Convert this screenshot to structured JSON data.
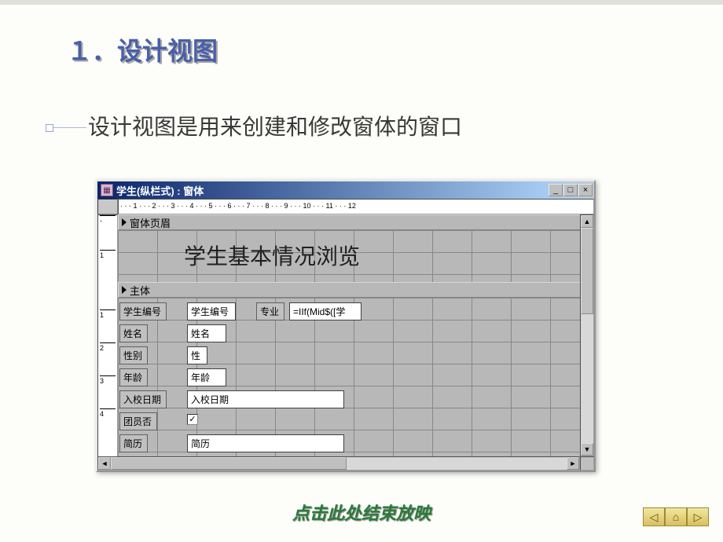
{
  "slide": {
    "title": "１．设计视图",
    "subtitle": "设计视图是用来创建和修改窗体的窗口",
    "footer": "点击此处结束放映"
  },
  "window": {
    "title": "学生(纵栏式) : 窗体",
    "hruler": "· · · 1 · · · 2 · · · 3 · · · 4 · · · 5 · · · 6 · · · 7 · · · 8 · · · 9 · · · 10 · · · 11 · · · 12",
    "sections": {
      "header": "窗体页眉",
      "body": "主体"
    },
    "header_title": "学生基本情况浏览",
    "fields": [
      {
        "label": "学生编号",
        "field": "学生编号",
        "label_pos": [
          2,
          6,
          60
        ],
        "field_pos": [
          88,
          6,
          62
        ]
      },
      {
        "label": "专业",
        "field": "=IIf(Mid$([学",
        "label_pos": [
          176,
          6,
          36
        ],
        "field_pos": [
          218,
          6,
          92
        ]
      },
      {
        "label": "姓名",
        "field": "姓名",
        "label_pos": [
          2,
          34,
          36
        ],
        "field_pos": [
          88,
          34,
          50
        ]
      },
      {
        "label": "性别",
        "field": "性",
        "label_pos": [
          2,
          62,
          36
        ],
        "field_pos": [
          88,
          62,
          26
        ]
      },
      {
        "label": "年龄",
        "field": "年龄",
        "label_pos": [
          2,
          90,
          36
        ],
        "field_pos": [
          88,
          90,
          50
        ]
      },
      {
        "label": "入校日期",
        "field": "入校日期",
        "label_pos": [
          2,
          118,
          60
        ],
        "field_pos": [
          88,
          118,
          200
        ]
      },
      {
        "label": "团员否",
        "field": "",
        "label_pos": [
          2,
          146,
          48
        ],
        "field_pos": [
          88,
          148,
          0
        ],
        "checkbox": true
      },
      {
        "label": "简历",
        "field": "简历",
        "label_pos": [
          2,
          174,
          36
        ],
        "field_pos": [
          88,
          174,
          200
        ]
      }
    ],
    "window_controls": {
      "min": "_",
      "max": "□",
      "close": "×"
    },
    "scroll_arrows": {
      "up": "▲",
      "down": "▼",
      "left": "◄",
      "right": "►"
    }
  },
  "nav": {
    "prev": "◁",
    "home": "⌂",
    "next": "▷"
  }
}
